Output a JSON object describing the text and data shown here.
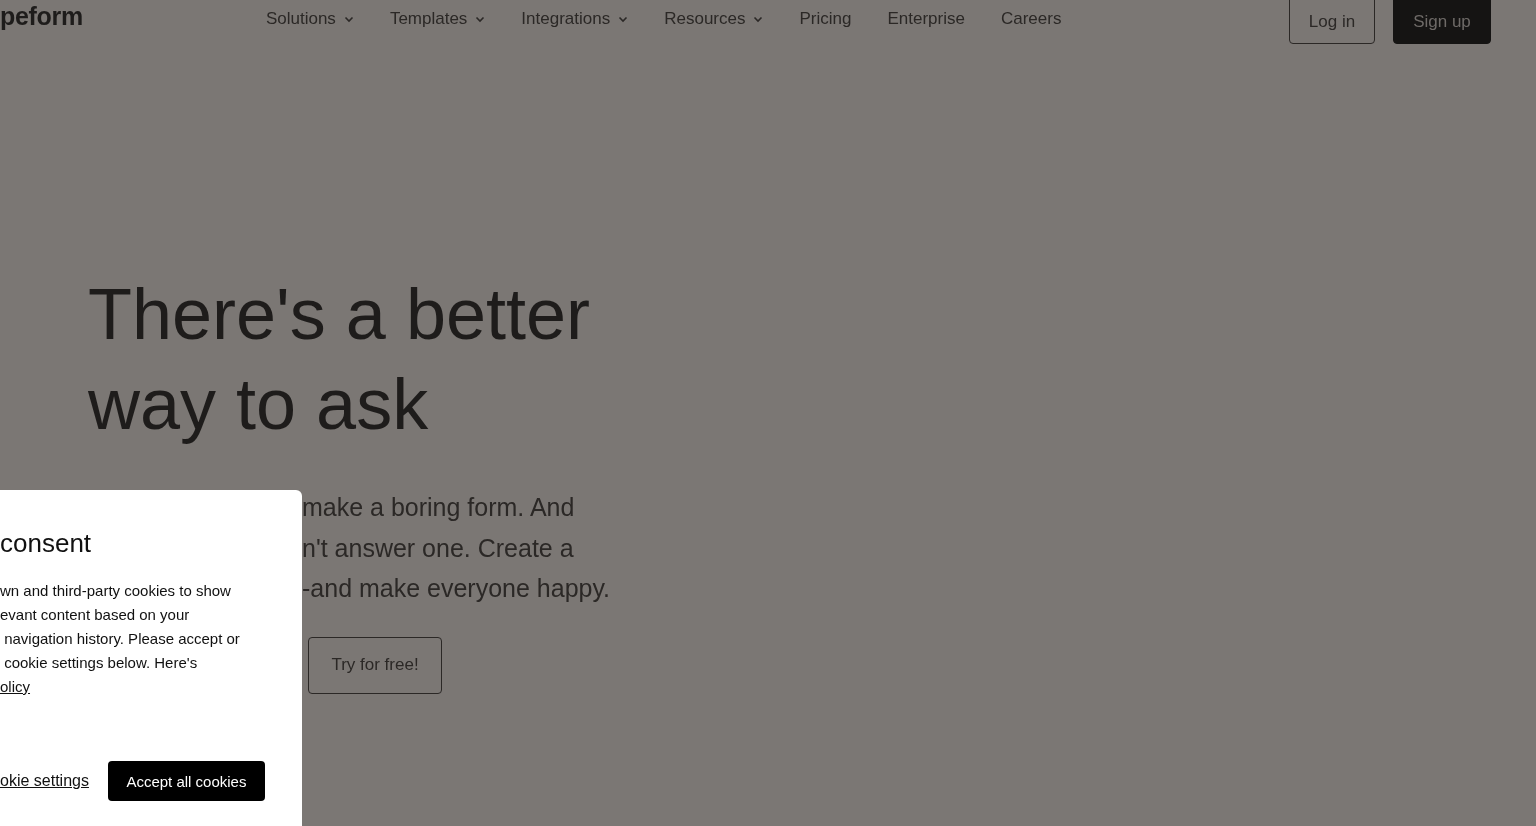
{
  "header": {
    "logo": "peform",
    "nav": [
      {
        "label": "Solutions",
        "kind": "dropdown"
      },
      {
        "label": "Templates",
        "kind": "dropdown"
      },
      {
        "label": "Integrations",
        "kind": "dropdown"
      },
      {
        "label": "Resources",
        "kind": "dropdown"
      },
      {
        "label": "Pricing",
        "kind": "link"
      },
      {
        "label": "Enterprise",
        "kind": "link"
      },
      {
        "label": "Careers",
        "kind": "link"
      }
    ],
    "login": "Log in",
    "signup": "Sign up"
  },
  "hero": {
    "title_lines": [
      "There's a better",
      "way to ask"
    ],
    "text_lines": [
      "make a boring form. And",
      "n't answer one. Create a",
      "-and make everyone happy."
    ],
    "cta": "Try for free!"
  },
  "cookie_dialog": {
    "title": "consent",
    "body_lines": [
      "wn and third-party cookies to show",
      "evant content based on your",
      " navigation history. Please accept or",
      " cookie settings below. Here's"
    ],
    "policy_link": "olicy",
    "settings_link": "okie settings",
    "accept": "Accept all cookies"
  }
}
